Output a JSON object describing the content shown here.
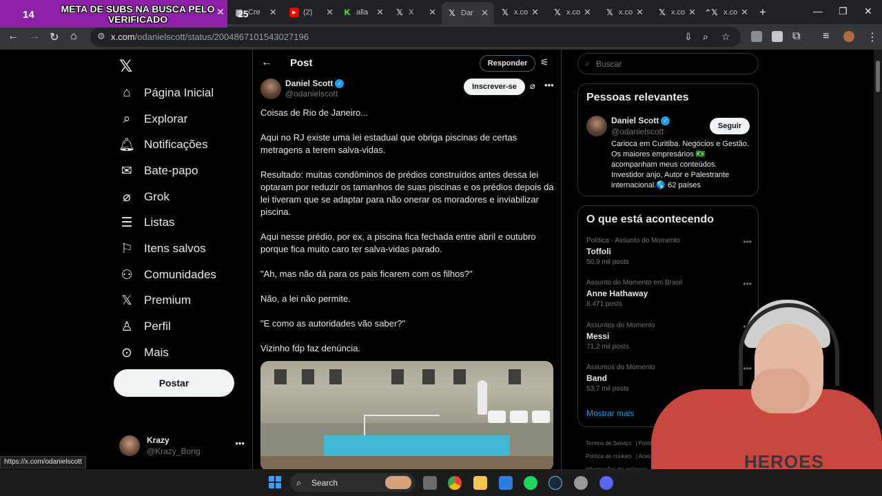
{
  "overlay": {
    "number": "14",
    "text": "META DE SUBS NA BUSCA PELO VERIFICADO",
    "tab_number": "25"
  },
  "browser": {
    "tabs": [
      {
        "label": "Cre",
        "icon": "page-icon"
      },
      {
        "label": "(2)",
        "icon": "youtube-icon"
      },
      {
        "label": "alla",
        "icon": "kick-icon"
      },
      {
        "label": "X",
        "icon": "x-icon"
      },
      {
        "label": "Dar",
        "icon": "x-icon",
        "active": true
      },
      {
        "label": "x.co",
        "icon": "x-icon"
      },
      {
        "label": "x.co",
        "icon": "x-icon"
      },
      {
        "label": "x.co",
        "icon": "x-icon"
      },
      {
        "label": "x.co",
        "icon": "x-icon"
      },
      {
        "label": "x.co",
        "icon": "x-icon"
      }
    ],
    "url_host": "x.com",
    "url_path": "/odanielscott/status/2004867101543027196",
    "status_url": "https://x.com/odanielscott"
  },
  "nav": {
    "items": [
      {
        "label": "Página Inicial",
        "icon": "home-icon"
      },
      {
        "label": "Explorar",
        "icon": "search-icon"
      },
      {
        "label": "Notificações",
        "icon": "bell-icon"
      },
      {
        "label": "Bate-papo",
        "icon": "mail-icon"
      },
      {
        "label": "Grok",
        "icon": "grok-icon"
      },
      {
        "label": "Listas",
        "icon": "list-icon"
      },
      {
        "label": "Itens salvos",
        "icon": "bookmark-icon"
      },
      {
        "label": "Comunidades",
        "icon": "communities-icon"
      },
      {
        "label": "Premium",
        "icon": "x-icon"
      },
      {
        "label": "Perfil",
        "icon": "person-icon"
      },
      {
        "label": "Mais",
        "icon": "more-circle-icon"
      }
    ],
    "post_button": "Postar",
    "me": {
      "name": "Krazy",
      "handle": "@Krazy_Bong"
    }
  },
  "post": {
    "header_title": "Post",
    "reply_button": "Responder",
    "author": {
      "name": "Daniel Scott",
      "handle": "@odanielscott"
    },
    "subscribe_button": "Inscrever-se",
    "paragraphs": [
      "Coisas de Rio de Janeiro...",
      "Aqui no RJ existe uma lei estadual que obriga piscinas de certas metragens a terem salva-vidas.",
      "Resultado: muitas condôminos de prédios construídos antes dessa lei optaram por reduzir os tamanhos de suas piscinas e os prédios depois da lei tiveram que se adaptar para não onerar os moradores e inviabilizar piscina.",
      "Aqui nesse prédio, por ex, a piscina fica fechada entre abril e outubro porque fica muito caro ter salva-vidas parado.",
      "\"Ah, mas não dá para os pais ficarem com os filhos?\"",
      "Não, a lei não permite.",
      "\"E como as autoridades vão saber?\"",
      "Vizinho fdp faz denúncia."
    ]
  },
  "sidebar": {
    "search_placeholder": "Buscar",
    "relevant": {
      "title": "Pessoas relevantes",
      "name": "Daniel Scott",
      "handle": "@odanielscott",
      "follow_button": "Seguir",
      "bio": "Carioca em Curitiba. Negócios e Gestão. Os maiores empresários 🇧🇷 acompanham meus conteúdos. Investidor anjo, Autor e Palestrante internacional.🌎 62 países"
    },
    "trends": {
      "title": "O que está acontecendo",
      "items": [
        {
          "context": "Política · Assunto do Momento",
          "name": "Toffoli",
          "count": "50,9 mil posts"
        },
        {
          "context": "Assunto do Momento em Brasil",
          "name": "Anne Hathaway",
          "count": "8.471 posts"
        },
        {
          "context": "Assuntos do Momento",
          "name": "Messi",
          "count": "71,2 mil posts"
        },
        {
          "context": "Assuntos do Momento",
          "name": "Band",
          "count": "53,7 mil posts"
        }
      ],
      "show_more": "Mostrar mais"
    },
    "footer": [
      "Termos de Serviço",
      "Política de Pri",
      "Política de cookies",
      "Aces",
      "Informações de anúncios"
    ]
  },
  "webcam": {
    "shirt_text": "HEROES"
  },
  "taskbar": {
    "search_label": "Search"
  },
  "colors": {
    "accent": "#1d9bf0",
    "overlay": "#8e1fa8",
    "background": "#000000"
  }
}
